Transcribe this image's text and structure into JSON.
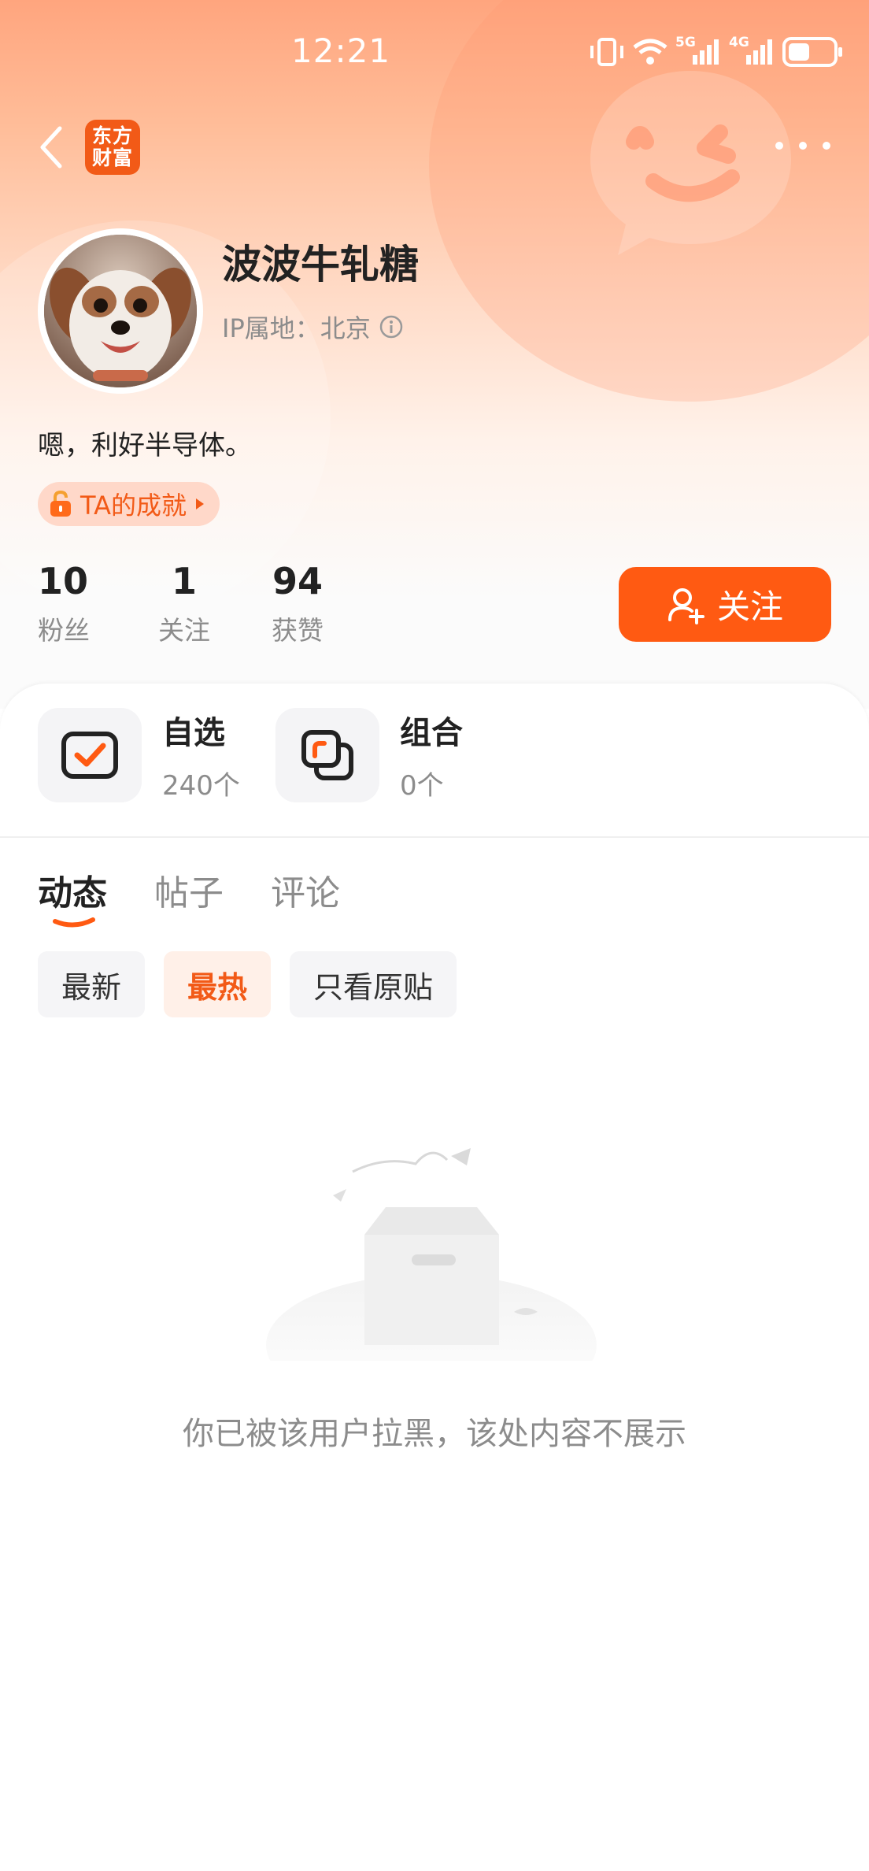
{
  "status_bar": {
    "time": "12:21",
    "network_1": "5G",
    "network_2": "4G"
  },
  "nav": {
    "logo_line1": "东方",
    "logo_line2": "财富"
  },
  "profile": {
    "username": "波波牛轧糖",
    "ip_location": "IP属地：北京",
    "bio": "嗯，利好半导体。",
    "achievement_label": "TA的成就"
  },
  "stats": [
    {
      "value": "10",
      "label": "粉丝"
    },
    {
      "value": "1",
      "label": "关注"
    },
    {
      "value": "94",
      "label": "获赞"
    }
  ],
  "follow_button": {
    "label": "关注"
  },
  "shortcuts": [
    {
      "title": "自选",
      "count": "240个"
    },
    {
      "title": "组合",
      "count": "0个"
    }
  ],
  "tabs": [
    {
      "label": "动态",
      "active": true
    },
    {
      "label": "帖子",
      "active": false
    },
    {
      "label": "评论",
      "active": false
    }
  ],
  "filters": [
    {
      "label": "最新",
      "active": false
    },
    {
      "label": "最热",
      "active": true
    },
    {
      "label": "只看原贴",
      "active": false
    }
  ],
  "empty_state": {
    "message": "你已被该用户拉黑，该处内容不展示"
  },
  "colors": {
    "accent": "#ff5a12",
    "brand": "#f25a17",
    "muted_text": "#8c8c8c"
  }
}
